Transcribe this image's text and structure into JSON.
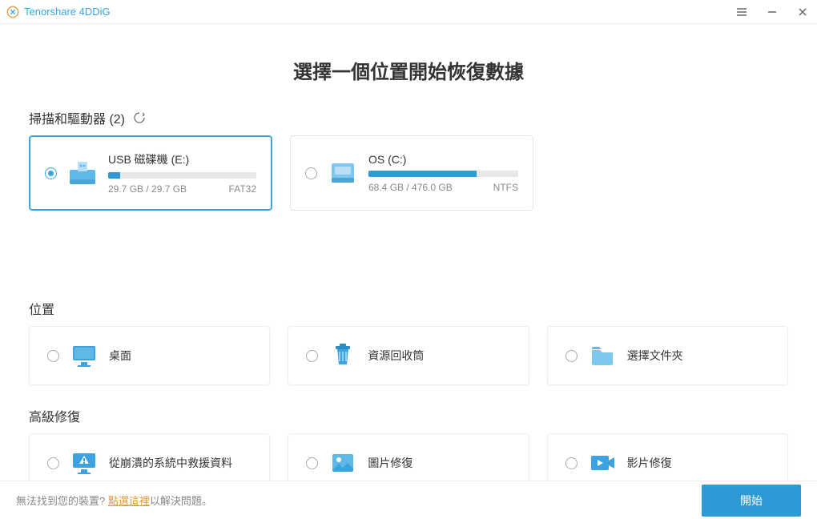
{
  "app": {
    "title": "Tenorshare 4DDiG"
  },
  "main_title": "選擇一個位置開始恢復數據",
  "drives_section": {
    "title": "掃描和驅動器 (2)",
    "items": [
      {
        "name": "USB 磁碟機 (E:)",
        "used_label": "29.7 GB / 29.7 GB",
        "fs": "FAT32",
        "fill_pct": 8,
        "selected": true
      },
      {
        "name": "OS (C:)",
        "used_label": "68.4 GB / 476.0 GB",
        "fs": "NTFS",
        "fill_pct": 72,
        "selected": false
      }
    ]
  },
  "locations_section": {
    "title": "位置",
    "items": [
      {
        "label": "桌面"
      },
      {
        "label": "資源回收筒"
      },
      {
        "label": "選擇文件夾"
      }
    ]
  },
  "advanced_section": {
    "title": "高級修復",
    "items": [
      {
        "label": "從崩潰的系統中救援資料"
      },
      {
        "label": "圖片修復"
      },
      {
        "label": "影片修復"
      }
    ]
  },
  "footer": {
    "prefix": "無法找到您的裝置? ",
    "link": "點選這裡",
    "suffix": "以解決問題。",
    "start": "開始"
  }
}
